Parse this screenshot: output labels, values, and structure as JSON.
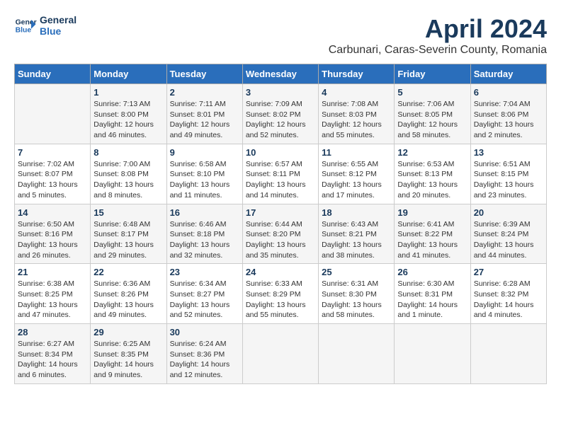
{
  "header": {
    "logo_line1": "General",
    "logo_line2": "Blue",
    "title": "April 2024",
    "subtitle": "Carbunari, Caras-Severin County, Romania"
  },
  "days_of_week": [
    "Sunday",
    "Monday",
    "Tuesday",
    "Wednesday",
    "Thursday",
    "Friday",
    "Saturday"
  ],
  "weeks": [
    [
      {
        "day": "",
        "info": ""
      },
      {
        "day": "1",
        "info": "Sunrise: 7:13 AM\nSunset: 8:00 PM\nDaylight: 12 hours\nand 46 minutes."
      },
      {
        "day": "2",
        "info": "Sunrise: 7:11 AM\nSunset: 8:01 PM\nDaylight: 12 hours\nand 49 minutes."
      },
      {
        "day": "3",
        "info": "Sunrise: 7:09 AM\nSunset: 8:02 PM\nDaylight: 12 hours\nand 52 minutes."
      },
      {
        "day": "4",
        "info": "Sunrise: 7:08 AM\nSunset: 8:03 PM\nDaylight: 12 hours\nand 55 minutes."
      },
      {
        "day": "5",
        "info": "Sunrise: 7:06 AM\nSunset: 8:05 PM\nDaylight: 12 hours\nand 58 minutes."
      },
      {
        "day": "6",
        "info": "Sunrise: 7:04 AM\nSunset: 8:06 PM\nDaylight: 13 hours\nand 2 minutes."
      }
    ],
    [
      {
        "day": "7",
        "info": "Sunrise: 7:02 AM\nSunset: 8:07 PM\nDaylight: 13 hours\nand 5 minutes."
      },
      {
        "day": "8",
        "info": "Sunrise: 7:00 AM\nSunset: 8:08 PM\nDaylight: 13 hours\nand 8 minutes."
      },
      {
        "day": "9",
        "info": "Sunrise: 6:58 AM\nSunset: 8:10 PM\nDaylight: 13 hours\nand 11 minutes."
      },
      {
        "day": "10",
        "info": "Sunrise: 6:57 AM\nSunset: 8:11 PM\nDaylight: 13 hours\nand 14 minutes."
      },
      {
        "day": "11",
        "info": "Sunrise: 6:55 AM\nSunset: 8:12 PM\nDaylight: 13 hours\nand 17 minutes."
      },
      {
        "day": "12",
        "info": "Sunrise: 6:53 AM\nSunset: 8:13 PM\nDaylight: 13 hours\nand 20 minutes."
      },
      {
        "day": "13",
        "info": "Sunrise: 6:51 AM\nSunset: 8:15 PM\nDaylight: 13 hours\nand 23 minutes."
      }
    ],
    [
      {
        "day": "14",
        "info": "Sunrise: 6:50 AM\nSunset: 8:16 PM\nDaylight: 13 hours\nand 26 minutes."
      },
      {
        "day": "15",
        "info": "Sunrise: 6:48 AM\nSunset: 8:17 PM\nDaylight: 13 hours\nand 29 minutes."
      },
      {
        "day": "16",
        "info": "Sunrise: 6:46 AM\nSunset: 8:18 PM\nDaylight: 13 hours\nand 32 minutes."
      },
      {
        "day": "17",
        "info": "Sunrise: 6:44 AM\nSunset: 8:20 PM\nDaylight: 13 hours\nand 35 minutes."
      },
      {
        "day": "18",
        "info": "Sunrise: 6:43 AM\nSunset: 8:21 PM\nDaylight: 13 hours\nand 38 minutes."
      },
      {
        "day": "19",
        "info": "Sunrise: 6:41 AM\nSunset: 8:22 PM\nDaylight: 13 hours\nand 41 minutes."
      },
      {
        "day": "20",
        "info": "Sunrise: 6:39 AM\nSunset: 8:24 PM\nDaylight: 13 hours\nand 44 minutes."
      }
    ],
    [
      {
        "day": "21",
        "info": "Sunrise: 6:38 AM\nSunset: 8:25 PM\nDaylight: 13 hours\nand 47 minutes."
      },
      {
        "day": "22",
        "info": "Sunrise: 6:36 AM\nSunset: 8:26 PM\nDaylight: 13 hours\nand 49 minutes."
      },
      {
        "day": "23",
        "info": "Sunrise: 6:34 AM\nSunset: 8:27 PM\nDaylight: 13 hours\nand 52 minutes."
      },
      {
        "day": "24",
        "info": "Sunrise: 6:33 AM\nSunset: 8:29 PM\nDaylight: 13 hours\nand 55 minutes."
      },
      {
        "day": "25",
        "info": "Sunrise: 6:31 AM\nSunset: 8:30 PM\nDaylight: 13 hours\nand 58 minutes."
      },
      {
        "day": "26",
        "info": "Sunrise: 6:30 AM\nSunset: 8:31 PM\nDaylight: 14 hours\nand 1 minute."
      },
      {
        "day": "27",
        "info": "Sunrise: 6:28 AM\nSunset: 8:32 PM\nDaylight: 14 hours\nand 4 minutes."
      }
    ],
    [
      {
        "day": "28",
        "info": "Sunrise: 6:27 AM\nSunset: 8:34 PM\nDaylight: 14 hours\nand 6 minutes."
      },
      {
        "day": "29",
        "info": "Sunrise: 6:25 AM\nSunset: 8:35 PM\nDaylight: 14 hours\nand 9 minutes."
      },
      {
        "day": "30",
        "info": "Sunrise: 6:24 AM\nSunset: 8:36 PM\nDaylight: 14 hours\nand 12 minutes."
      },
      {
        "day": "",
        "info": ""
      },
      {
        "day": "",
        "info": ""
      },
      {
        "day": "",
        "info": ""
      },
      {
        "day": "",
        "info": ""
      }
    ]
  ]
}
